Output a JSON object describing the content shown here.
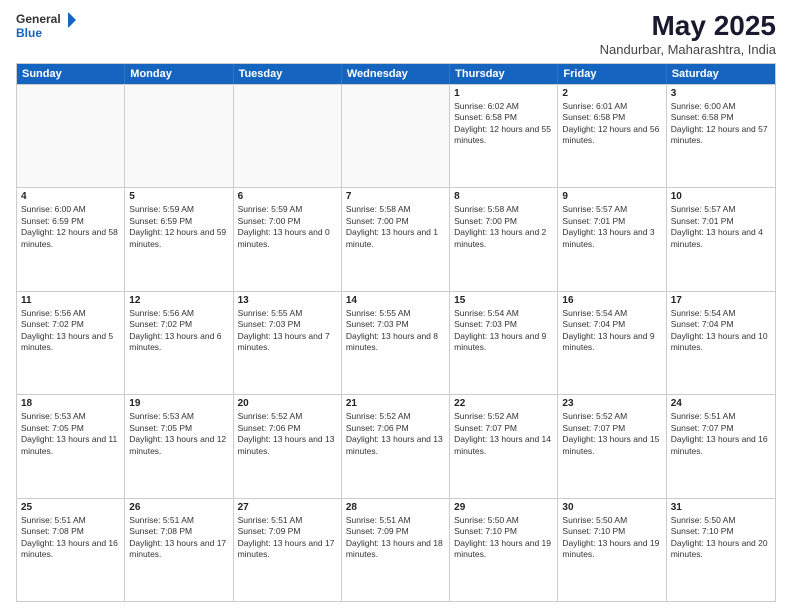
{
  "logo": {
    "text_general": "General",
    "text_blue": "Blue"
  },
  "title": {
    "month": "May 2025",
    "location": "Nandurbar, Maharashtra, India"
  },
  "header_days": [
    "Sunday",
    "Monday",
    "Tuesday",
    "Wednesday",
    "Thursday",
    "Friday",
    "Saturday"
  ],
  "rows": [
    [
      {
        "day": "",
        "sunrise": "",
        "sunset": "",
        "daylight": "",
        "empty": true
      },
      {
        "day": "",
        "sunrise": "",
        "sunset": "",
        "daylight": "",
        "empty": true
      },
      {
        "day": "",
        "sunrise": "",
        "sunset": "",
        "daylight": "",
        "empty": true
      },
      {
        "day": "",
        "sunrise": "",
        "sunset": "",
        "daylight": "",
        "empty": true
      },
      {
        "day": "1",
        "sunrise": "Sunrise: 6:02 AM",
        "sunset": "Sunset: 6:58 PM",
        "daylight": "Daylight: 12 hours and 55 minutes."
      },
      {
        "day": "2",
        "sunrise": "Sunrise: 6:01 AM",
        "sunset": "Sunset: 6:58 PM",
        "daylight": "Daylight: 12 hours and 56 minutes."
      },
      {
        "day": "3",
        "sunrise": "Sunrise: 6:00 AM",
        "sunset": "Sunset: 6:58 PM",
        "daylight": "Daylight: 12 hours and 57 minutes."
      }
    ],
    [
      {
        "day": "4",
        "sunrise": "Sunrise: 6:00 AM",
        "sunset": "Sunset: 6:59 PM",
        "daylight": "Daylight: 12 hours and 58 minutes."
      },
      {
        "day": "5",
        "sunrise": "Sunrise: 5:59 AM",
        "sunset": "Sunset: 6:59 PM",
        "daylight": "Daylight: 12 hours and 59 minutes."
      },
      {
        "day": "6",
        "sunrise": "Sunrise: 5:59 AM",
        "sunset": "Sunset: 7:00 PM",
        "daylight": "Daylight: 13 hours and 0 minutes."
      },
      {
        "day": "7",
        "sunrise": "Sunrise: 5:58 AM",
        "sunset": "Sunset: 7:00 PM",
        "daylight": "Daylight: 13 hours and 1 minute."
      },
      {
        "day": "8",
        "sunrise": "Sunrise: 5:58 AM",
        "sunset": "Sunset: 7:00 PM",
        "daylight": "Daylight: 13 hours and 2 minutes."
      },
      {
        "day": "9",
        "sunrise": "Sunrise: 5:57 AM",
        "sunset": "Sunset: 7:01 PM",
        "daylight": "Daylight: 13 hours and 3 minutes."
      },
      {
        "day": "10",
        "sunrise": "Sunrise: 5:57 AM",
        "sunset": "Sunset: 7:01 PM",
        "daylight": "Daylight: 13 hours and 4 minutes."
      }
    ],
    [
      {
        "day": "11",
        "sunrise": "Sunrise: 5:56 AM",
        "sunset": "Sunset: 7:02 PM",
        "daylight": "Daylight: 13 hours and 5 minutes."
      },
      {
        "day": "12",
        "sunrise": "Sunrise: 5:56 AM",
        "sunset": "Sunset: 7:02 PM",
        "daylight": "Daylight: 13 hours and 6 minutes."
      },
      {
        "day": "13",
        "sunrise": "Sunrise: 5:55 AM",
        "sunset": "Sunset: 7:03 PM",
        "daylight": "Daylight: 13 hours and 7 minutes."
      },
      {
        "day": "14",
        "sunrise": "Sunrise: 5:55 AM",
        "sunset": "Sunset: 7:03 PM",
        "daylight": "Daylight: 13 hours and 8 minutes."
      },
      {
        "day": "15",
        "sunrise": "Sunrise: 5:54 AM",
        "sunset": "Sunset: 7:03 PM",
        "daylight": "Daylight: 13 hours and 9 minutes."
      },
      {
        "day": "16",
        "sunrise": "Sunrise: 5:54 AM",
        "sunset": "Sunset: 7:04 PM",
        "daylight": "Daylight: 13 hours and 9 minutes."
      },
      {
        "day": "17",
        "sunrise": "Sunrise: 5:54 AM",
        "sunset": "Sunset: 7:04 PM",
        "daylight": "Daylight: 13 hours and 10 minutes."
      }
    ],
    [
      {
        "day": "18",
        "sunrise": "Sunrise: 5:53 AM",
        "sunset": "Sunset: 7:05 PM",
        "daylight": "Daylight: 13 hours and 11 minutes."
      },
      {
        "day": "19",
        "sunrise": "Sunrise: 5:53 AM",
        "sunset": "Sunset: 7:05 PM",
        "daylight": "Daylight: 13 hours and 12 minutes."
      },
      {
        "day": "20",
        "sunrise": "Sunrise: 5:52 AM",
        "sunset": "Sunset: 7:06 PM",
        "daylight": "Daylight: 13 hours and 13 minutes."
      },
      {
        "day": "21",
        "sunrise": "Sunrise: 5:52 AM",
        "sunset": "Sunset: 7:06 PM",
        "daylight": "Daylight: 13 hours and 13 minutes."
      },
      {
        "day": "22",
        "sunrise": "Sunrise: 5:52 AM",
        "sunset": "Sunset: 7:07 PM",
        "daylight": "Daylight: 13 hours and 14 minutes."
      },
      {
        "day": "23",
        "sunrise": "Sunrise: 5:52 AM",
        "sunset": "Sunset: 7:07 PM",
        "daylight": "Daylight: 13 hours and 15 minutes."
      },
      {
        "day": "24",
        "sunrise": "Sunrise: 5:51 AM",
        "sunset": "Sunset: 7:07 PM",
        "daylight": "Daylight: 13 hours and 16 minutes."
      }
    ],
    [
      {
        "day": "25",
        "sunrise": "Sunrise: 5:51 AM",
        "sunset": "Sunset: 7:08 PM",
        "daylight": "Daylight: 13 hours and 16 minutes."
      },
      {
        "day": "26",
        "sunrise": "Sunrise: 5:51 AM",
        "sunset": "Sunset: 7:08 PM",
        "daylight": "Daylight: 13 hours and 17 minutes."
      },
      {
        "day": "27",
        "sunrise": "Sunrise: 5:51 AM",
        "sunset": "Sunset: 7:09 PM",
        "daylight": "Daylight: 13 hours and 17 minutes."
      },
      {
        "day": "28",
        "sunrise": "Sunrise: 5:51 AM",
        "sunset": "Sunset: 7:09 PM",
        "daylight": "Daylight: 13 hours and 18 minutes."
      },
      {
        "day": "29",
        "sunrise": "Sunrise: 5:50 AM",
        "sunset": "Sunset: 7:10 PM",
        "daylight": "Daylight: 13 hours and 19 minutes."
      },
      {
        "day": "30",
        "sunrise": "Sunrise: 5:50 AM",
        "sunset": "Sunset: 7:10 PM",
        "daylight": "Daylight: 13 hours and 19 minutes."
      },
      {
        "day": "31",
        "sunrise": "Sunrise: 5:50 AM",
        "sunset": "Sunset: 7:10 PM",
        "daylight": "Daylight: 13 hours and 20 minutes."
      }
    ]
  ]
}
